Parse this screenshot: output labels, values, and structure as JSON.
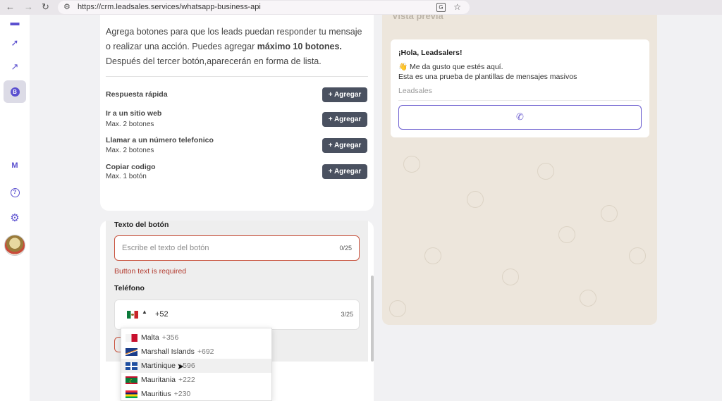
{
  "browser": {
    "url": "https://crm.leadsales.services/whatsapp-business-api",
    "back_icon": "arrow-left-icon",
    "forward_icon": "arrow-right-icon",
    "reload_icon": "reload-icon"
  },
  "sidebar": {
    "help_glyph": "?",
    "badge_letter": "B",
    "m_letter": "M"
  },
  "buttons_section": {
    "intro_part1": "Agrega botones para que los leads puedan responder tu mensaje o realizar una acción. Puedes agregar ",
    "intro_bold": "máximo 10 botones.",
    "intro_part2": " Después del tercer botón,aparecerán en forma de lista.",
    "options": [
      {
        "title": "Respuesta rápida",
        "subtitle": "",
        "button": "+ Agregar"
      },
      {
        "title": "Ir a un sitio web",
        "subtitle": "Max. 2 botones",
        "button": "+ Agregar"
      },
      {
        "title": "Llamar a un número telefonico",
        "subtitle": "Max. 2 botones",
        "button": "+ Agregar"
      },
      {
        "title": "Copiar codigo",
        "subtitle": "Max. 1 botón",
        "button": "+ Agregar"
      }
    ]
  },
  "form": {
    "button_text_label": "Texto del botón",
    "button_text_placeholder": "Escribe el texto del botón",
    "button_text_counter": "0/25",
    "error": "Button text is required",
    "phone_label": "Teléfono",
    "phone_value": "+52",
    "phone_counter": "3/25"
  },
  "country_dropdown": [
    {
      "name": "Malta",
      "code": "+356"
    },
    {
      "name": "Marshall Islands",
      "code": "+692"
    },
    {
      "name": "Martinique",
      "code": "+596"
    },
    {
      "name": "Mauritania",
      "code": "+222"
    },
    {
      "name": "Mauritius",
      "code": "+230"
    }
  ],
  "preview": {
    "title": "Vista previa",
    "message_title": "¡Hola, Leadsalers!",
    "message_line1": "👋 Me da gusto que estés aquí.",
    "message_line2": "Esta es una prueba de plantillas de mensajes masivos",
    "footer": "Leadsales",
    "call_icon": "phone-icon"
  }
}
